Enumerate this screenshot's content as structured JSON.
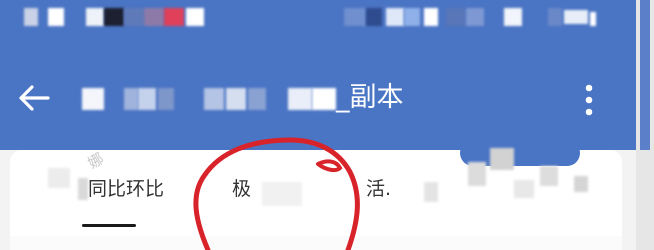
{
  "header": {
    "back_icon": "arrow-left-icon",
    "title_suffix": "_副本",
    "more_icon": "more-vertical-icon"
  },
  "watermark": "娜",
  "tabs": [
    {
      "label": "同比环比",
      "selected": true
    },
    {
      "label": "极",
      "selected": false
    },
    {
      "label": "活.",
      "selected": false
    }
  ],
  "colors": {
    "appbar": "#4a74c4",
    "annotation_circle": "#d9232a",
    "tab_text": "#333333"
  }
}
